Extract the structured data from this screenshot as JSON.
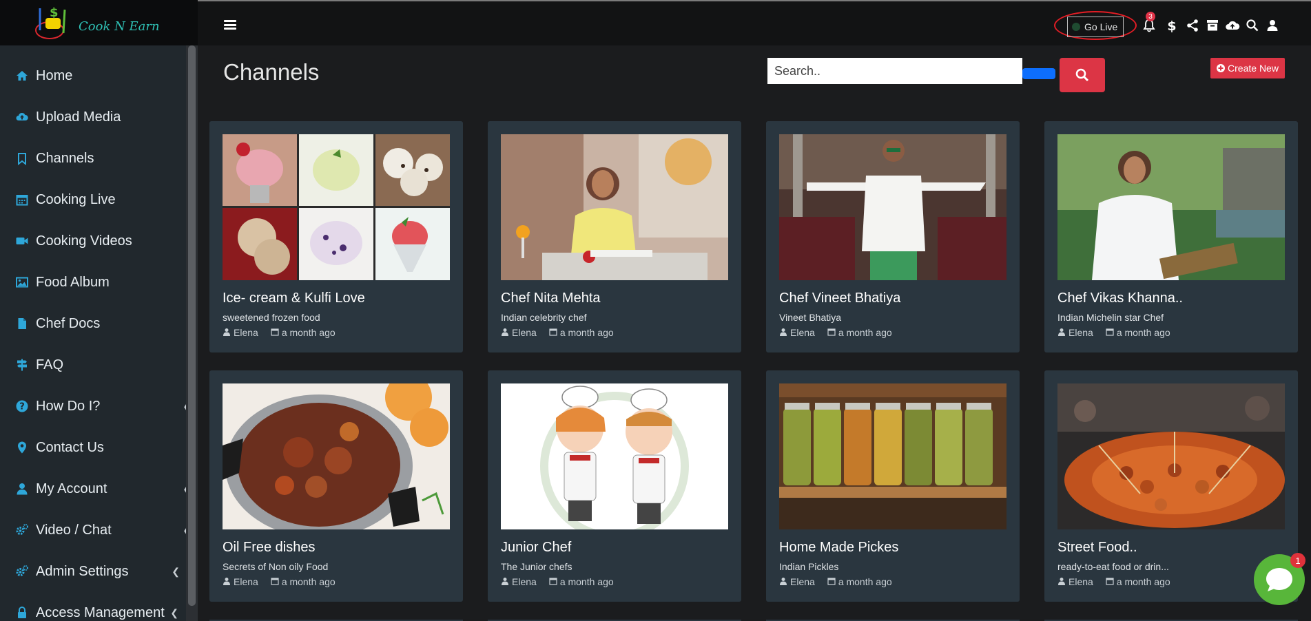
{
  "app": {
    "logo_text": "Cook N Earn"
  },
  "sidebar": {
    "items": [
      {
        "label": "Home",
        "icon": "home-icon"
      },
      {
        "label": "Upload Media",
        "icon": "cloud-upload-icon"
      },
      {
        "label": "Channels",
        "icon": "bookmark-icon"
      },
      {
        "label": "Cooking Live",
        "icon": "calendar-icon"
      },
      {
        "label": "Cooking Videos",
        "icon": "video-camera-icon"
      },
      {
        "label": "Food Album",
        "icon": "image-icon"
      },
      {
        "label": "Chef Docs",
        "icon": "document-icon"
      },
      {
        "label": "FAQ",
        "icon": "signpost-icon"
      },
      {
        "label": "How Do I?",
        "icon": "question-circle-icon",
        "chevron": true
      },
      {
        "label": "Contact Us",
        "icon": "map-marker-icon"
      },
      {
        "label": "My Account",
        "icon": "user-icon",
        "chevron": true
      },
      {
        "label": "Video / Chat",
        "icon": "cogs-icon",
        "chevron": true
      },
      {
        "label": "Admin Settings",
        "icon": "cogs-icon",
        "chevron": true
      },
      {
        "label": "Access Management",
        "icon": "lock-icon",
        "chevron": true
      }
    ]
  },
  "topbar": {
    "go_live_label": "Go Live",
    "notification_count": "3"
  },
  "main": {
    "title": "Channels",
    "search_placeholder": "Search..",
    "create_label": "Create New",
    "cards": [
      {
        "title": "Ice- cream & Kulfi Love",
        "subtitle": "sweetened frozen food",
        "author": "Elena",
        "time": "a month ago",
        "thumb": "ice-cream-collage"
      },
      {
        "title": "Chef Nita Mehta",
        "subtitle": "Indian celebrity chef",
        "author": "Elena",
        "time": "a month ago",
        "thumb": "chef-kitchen-woman"
      },
      {
        "title": "Chef Vineet Bhatiya",
        "subtitle": "Vineet Bhatiya",
        "author": "Elena",
        "time": "a month ago",
        "thumb": "chef-restaurant-man"
      },
      {
        "title": "Chef Vikas Khanna..",
        "subtitle": "Indian Michelin star Chef",
        "author": "Elena",
        "time": "a month ago",
        "thumb": "chef-park-man"
      },
      {
        "title": "Oil Free dishes",
        "subtitle": "Secrets of Non oily Food",
        "author": "Elena",
        "time": "a month ago",
        "thumb": "curry-pot"
      },
      {
        "title": "Junior Chef",
        "subtitle": "The Junior chefs",
        "author": "Elena",
        "time": "a month ago",
        "thumb": "kids-chefs-cartoon"
      },
      {
        "title": "Home Made Pickes",
        "subtitle": "Indian Pickles",
        "author": "Elena",
        "time": "a month ago",
        "thumb": "pickle-jars"
      },
      {
        "title": "Street Food..",
        "subtitle": "ready-to-eat food or drin...",
        "author": "Elena",
        "time": "a month ago",
        "thumb": "street-skewers"
      }
    ]
  },
  "chat": {
    "badge_count": "1"
  },
  "colors": {
    "accent_blue": "#2ea7d9",
    "danger_red": "#dc3545",
    "card_bg": "#2a363f",
    "chat_green": "#58b63a"
  }
}
